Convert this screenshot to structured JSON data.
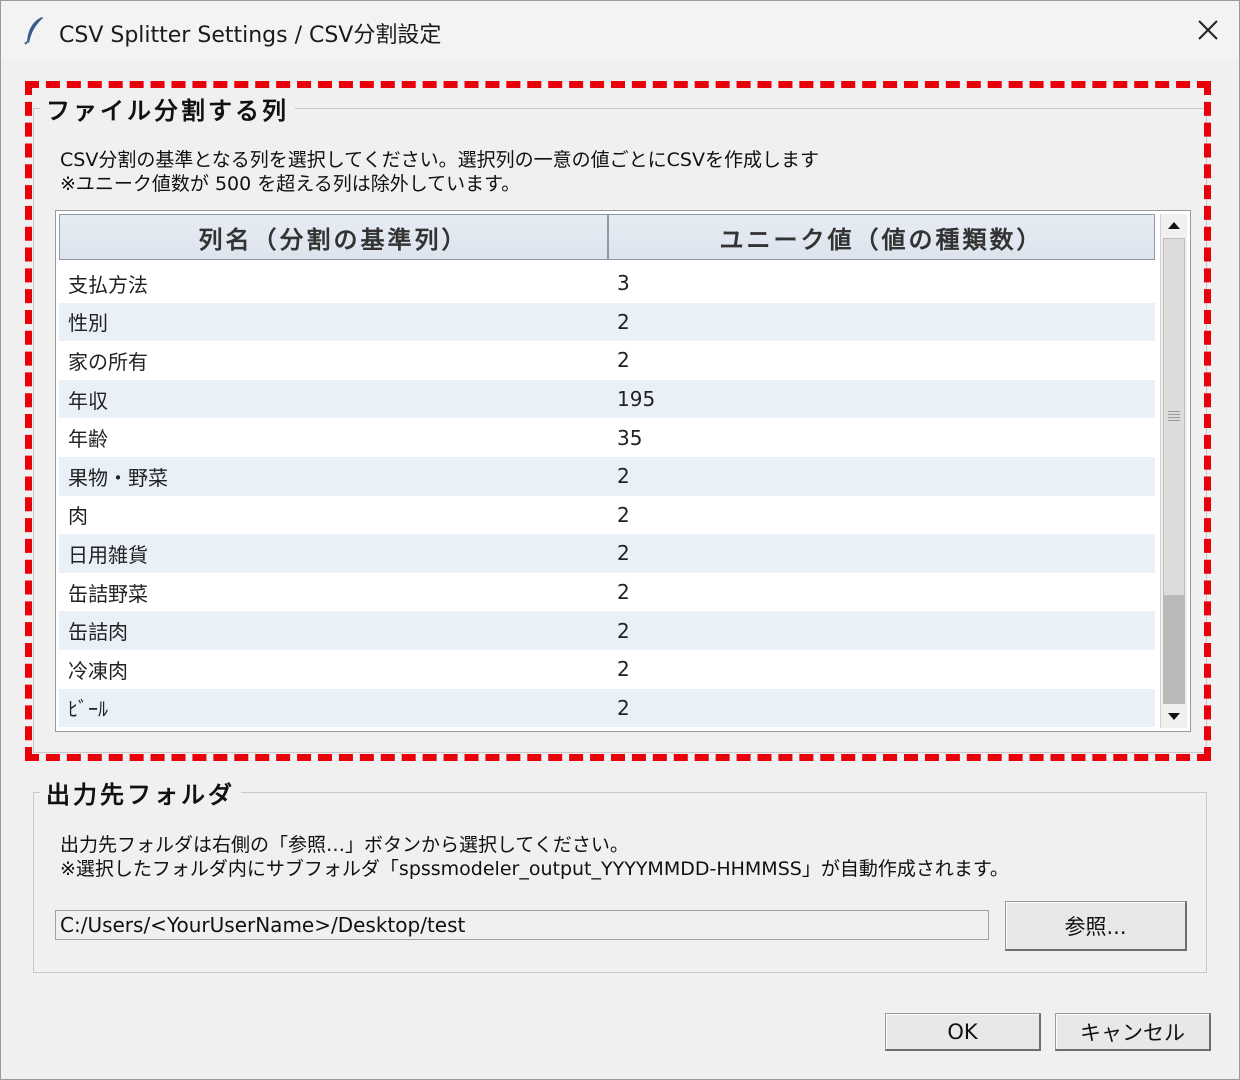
{
  "window": {
    "title": "CSV Splitter Settings / CSV分割設定"
  },
  "split_group": {
    "legend": "ファイル分割する列",
    "desc_line1": "CSV分割の基準となる列を選択してください。選択列の一意の値ごとにCSVを作成します",
    "desc_line2": "※ユニーク値数が 500 を超える列は除外しています。",
    "columns": [
      "列名（分割の基準列）",
      "ユニーク値（値の種類数）"
    ],
    "rows": [
      [
        "支払方法",
        "3"
      ],
      [
        "性別",
        "2"
      ],
      [
        "家の所有",
        "2"
      ],
      [
        "年収",
        "195"
      ],
      [
        "年齢",
        "35"
      ],
      [
        "果物・野菜",
        "2"
      ],
      [
        "肉",
        "2"
      ],
      [
        "日用雑貨",
        "2"
      ],
      [
        "缶詰野菜",
        "2"
      ],
      [
        "缶詰肉",
        "2"
      ],
      [
        "冷凍肉",
        "2"
      ],
      [
        "ﾋﾞｰﾙ",
        "2"
      ]
    ]
  },
  "output_group": {
    "legend": "出力先フォルダ",
    "desc_line1": "出力先フォルダは右側の「参照…」ボタンから選択してください。",
    "desc_line2": "※選択したフォルダ内にサブフォルダ「spssmodeler_output_YYYYMMDD-HHMMSS」が自動作成されます。",
    "path_value": "C:/Users/<YourUserName>/Desktop/test",
    "browse_label": "参照..."
  },
  "footer": {
    "ok_label": "OK",
    "cancel_label": "キャンセル"
  },
  "colors": {
    "highlight_dash": "#e8000b",
    "row_alt": "#eaf0f8",
    "header_bg": "#e2e8f1"
  },
  "icons": {
    "app": "feather-icon",
    "close": "close-icon",
    "scroll_up": "arrow-up-icon",
    "scroll_down": "arrow-down-icon"
  }
}
